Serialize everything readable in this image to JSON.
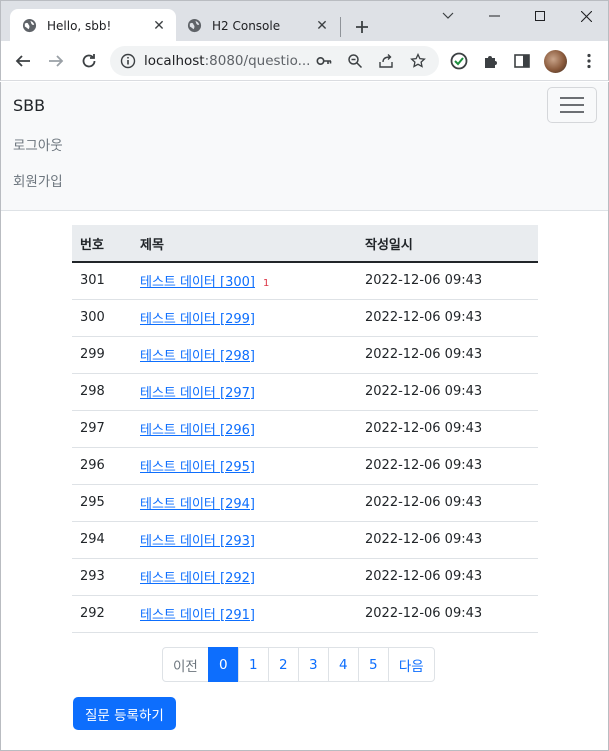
{
  "browser": {
    "tabs": [
      {
        "title": "Hello, sbb!",
        "icon": "globe-icon"
      },
      {
        "title": "H2 Console",
        "icon": "globe-icon"
      }
    ],
    "url_host": "localhost",
    "url_path": ":8080/questio..."
  },
  "navbar": {
    "brand": "SBB",
    "links": [
      "로그아웃",
      "회원가입"
    ]
  },
  "table": {
    "headers": [
      "번호",
      "제목",
      "작성일시"
    ],
    "rows": [
      {
        "num": "301",
        "subject": "테스트 데이터 [300]",
        "answers": "1",
        "date": "2022-12-06 09:43"
      },
      {
        "num": "300",
        "subject": "테스트 데이터 [299]",
        "answers": "",
        "date": "2022-12-06 09:43"
      },
      {
        "num": "299",
        "subject": "테스트 데이터 [298]",
        "answers": "",
        "date": "2022-12-06 09:43"
      },
      {
        "num": "298",
        "subject": "테스트 데이터 [297]",
        "answers": "",
        "date": "2022-12-06 09:43"
      },
      {
        "num": "297",
        "subject": "테스트 데이터 [296]",
        "answers": "",
        "date": "2022-12-06 09:43"
      },
      {
        "num": "296",
        "subject": "테스트 데이터 [295]",
        "answers": "",
        "date": "2022-12-06 09:43"
      },
      {
        "num": "295",
        "subject": "테스트 데이터 [294]",
        "answers": "",
        "date": "2022-12-06 09:43"
      },
      {
        "num": "294",
        "subject": "테스트 데이터 [293]",
        "answers": "",
        "date": "2022-12-06 09:43"
      },
      {
        "num": "293",
        "subject": "테스트 데이터 [292]",
        "answers": "",
        "date": "2022-12-06 09:43"
      },
      {
        "num": "292",
        "subject": "테스트 데이터 [291]",
        "answers": "",
        "date": "2022-12-06 09:43"
      }
    ]
  },
  "pagination": {
    "prev": "이전",
    "pages": [
      "0",
      "1",
      "2",
      "3",
      "4",
      "5"
    ],
    "active": "0",
    "next": "다음"
  },
  "create_button": "질문 등록하기",
  "colors": {
    "primary": "#0d6efd",
    "badge": "#dc3545"
  }
}
